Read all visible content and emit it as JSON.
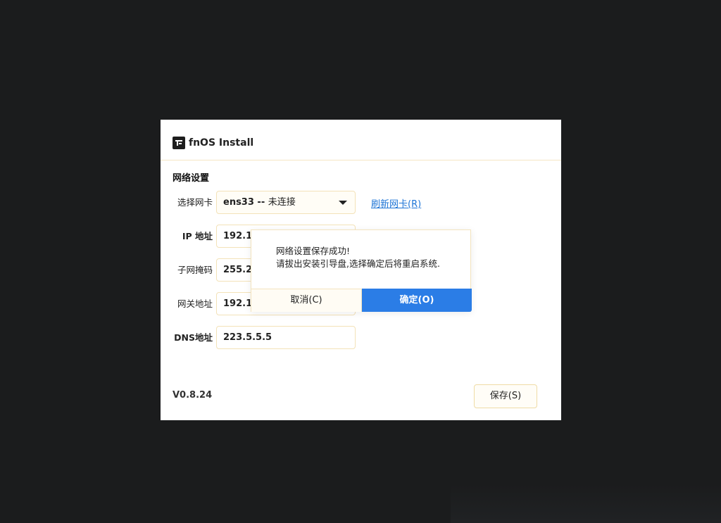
{
  "window": {
    "title": "fnOS Install",
    "logo_icon": "fnos-logo-icon"
  },
  "network": {
    "section_title": "网络设置",
    "nic": {
      "label": "选择网卡",
      "value_name": "ens33 --",
      "value_status": "未连接"
    },
    "refresh_label": "刷新网卡(R)",
    "ip": {
      "label": "IP 地址",
      "value": "192.1"
    },
    "netmask": {
      "label": "子网掩码",
      "value": "255.2"
    },
    "gateway": {
      "label": "网关地址",
      "value": "192.1"
    },
    "dns": {
      "label": "DNS地址",
      "value": "223.5.5.5"
    }
  },
  "footer": {
    "version": "V0.8.24",
    "save_label": "保存(S)"
  },
  "dialog": {
    "line1": "网络设置保存成功!",
    "line2": "请拔出安装引导盘,选择确定后将重启系统.",
    "cancel_label": "取消(C)",
    "ok_label": "确定(O)"
  },
  "colors": {
    "accent": "#2b7de6",
    "link": "#1d74d6",
    "border": "#f3e2b8",
    "background": "#1b1c1d"
  }
}
